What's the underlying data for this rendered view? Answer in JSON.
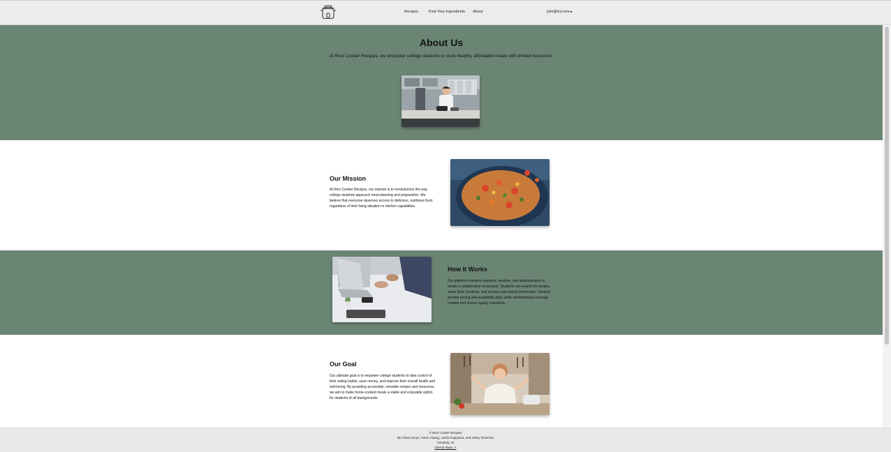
{
  "nav": {
    "logo_icon": "rice-cooker-icon",
    "links": [
      "Recipes",
      "Find Your Ingredients",
      "About"
    ],
    "user": "john@foo.com"
  },
  "hero": {
    "title": "About Us",
    "subtitle": "At Rice Cooker Recipes, we empower college students to cook healthy, affordable meals with limited resources.",
    "image": "person-cooking-in-kitchen-photo"
  },
  "mission": {
    "title": "Our Mission",
    "body": "At Rice Cooker Recipes, our mission is to revolutionize the way college students approach meal planning and preparation. We believe that everyone deserves access to delicious, nutritious food, regardless of their living situation or kitchen capabilities.",
    "image": "vegetable-rice-pan-photo"
  },
  "how": {
    "title": "How It Works",
    "body": "Our platform connects students, vendors, and administrators to create a collaborative ecosystem. Students can search for recipes, share their creations, and access cost-saving information. Vendors provide pricing and availability data, while administrators manage content and ensure quality standards.",
    "image": "business-meeting-laptop-photo"
  },
  "goal": {
    "title": "Our Goal",
    "body": "Our ultimate goal is to empower college students to take control of their eating habits, save money, and improve their overall health and well-being. By providing accessible, versatile recipes and resources, we aim to make home-cooked meals a viable and enjoyable option for students of all backgrounds.",
    "image": "woman-cooking-happy-photo"
  },
  "footer": {
    "copyright": "© Rice Cooker Recipes",
    "authors": "By Chiara Duyn, Anton Huang, Justin Kugiyama, and Haley Teramoto",
    "location": "Honolulu, HI",
    "repo_link": "GitHub Repo ↗"
  },
  "colors": {
    "band_green": "#6b8574",
    "navbar": "#ececec",
    "footer": "#e8e8e8"
  }
}
